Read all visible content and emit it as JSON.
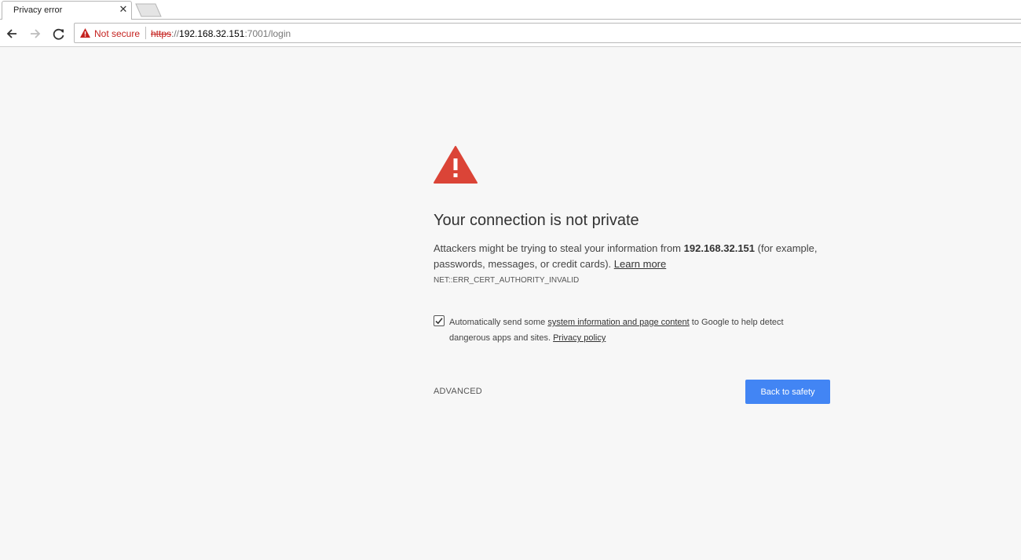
{
  "tab": {
    "title": "Privacy error",
    "close_glyph": "✕"
  },
  "toolbar": {
    "security_text": "Not secure",
    "url_scheme": "https",
    "url_sep": "://",
    "url_host": "192.168.32.151",
    "url_path": ":7001/login"
  },
  "interstitial": {
    "heading": "Your connection is not private",
    "explain_before": "Attackers might be trying to steal your information from ",
    "explain_host": "192.168.32.151",
    "explain_after": " (for example, passwords, messages, or credit cards). ",
    "learn_more": "Learn more",
    "error_code": "NET::ERR_CERT_AUTHORITY_INVALID",
    "optin_before": "Automatically send some ",
    "optin_link": "system information and page content",
    "optin_after": " to Google to help detect dangerous apps and sites. ",
    "privacy_policy": "Privacy policy",
    "optin_checked": true,
    "advanced_label": "ADVANCED",
    "primary_label": "Back to safety"
  },
  "colors": {
    "danger": "#db4437",
    "not_secure": "#c5221f",
    "primary_button": "#4285f4",
    "page_background": "#f7f7f7"
  },
  "icons": {
    "back": "arrow-left-icon",
    "forward": "arrow-right-icon",
    "reload": "reload-icon",
    "not_secure": "warning-triangle-icon",
    "interstitial": "warning-triangle-icon",
    "checkbox": "checkmark-icon"
  }
}
